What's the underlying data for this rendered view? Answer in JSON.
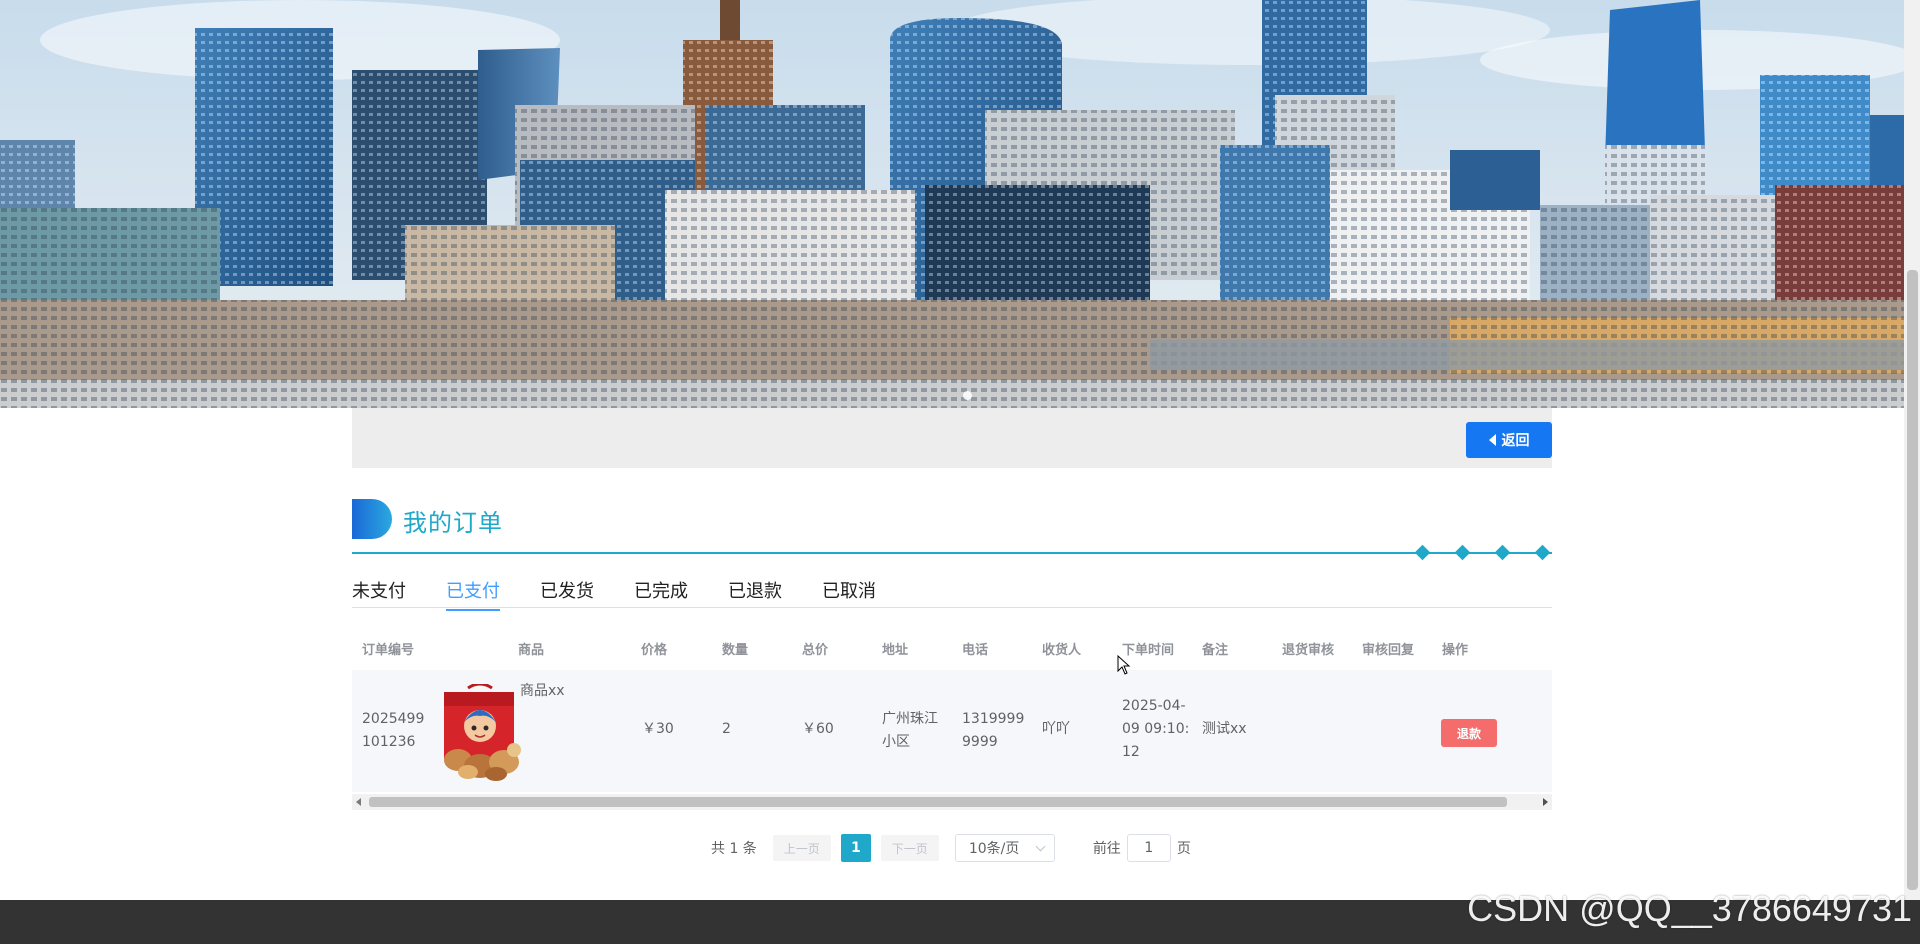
{
  "colors": {
    "accent": "#1fa8c9",
    "back_button": "#1577f1",
    "refund_button": "#f56c6c",
    "active_tab": "#409eff",
    "footer": "#333333"
  },
  "banner": {
    "alt": "city skyline banner"
  },
  "topbar": {
    "back_label": "返回",
    "back_icon": "caret-left-icon"
  },
  "section": {
    "title": "我的订单"
  },
  "tabs": [
    {
      "label": "未支付",
      "active": false
    },
    {
      "label": "已支付",
      "active": true
    },
    {
      "label": "已发货",
      "active": false
    },
    {
      "label": "已完成",
      "active": false
    },
    {
      "label": "已退款",
      "active": false
    },
    {
      "label": "已取消",
      "active": false
    }
  ],
  "table": {
    "columns": [
      "订单编号",
      "商品",
      "价格",
      "数量",
      "总价",
      "地址",
      "电话",
      "收货人",
      "下单时间",
      "备注",
      "退货审核",
      "审核回复",
      "操作"
    ],
    "rows": [
      {
        "order_no_line1": "2025499",
        "order_no_line2": "101236",
        "product_name": "商品xx",
        "price": "￥30",
        "quantity": "2",
        "total": "￥60",
        "address_line1": "广州珠江",
        "address_line2": "小区",
        "phone_line1": "1319999",
        "phone_line2": "9999",
        "receiver": "吖吖",
        "order_time_line1": "2025-04-",
        "order_time_line2": "09 09:10:",
        "order_time_line3": "12",
        "remark": "测试xx",
        "return_review": "",
        "review_reply": "",
        "action_label": "退款"
      }
    ]
  },
  "pagination": {
    "total_text": "共 1 条",
    "prev_label": "上一页",
    "current_page": "1",
    "next_label": "下一页",
    "page_size": "10条/页",
    "goto_prefix": "前往",
    "goto_value": "1",
    "goto_suffix": "页"
  },
  "watermark": "CSDN @QQ__3786649731"
}
